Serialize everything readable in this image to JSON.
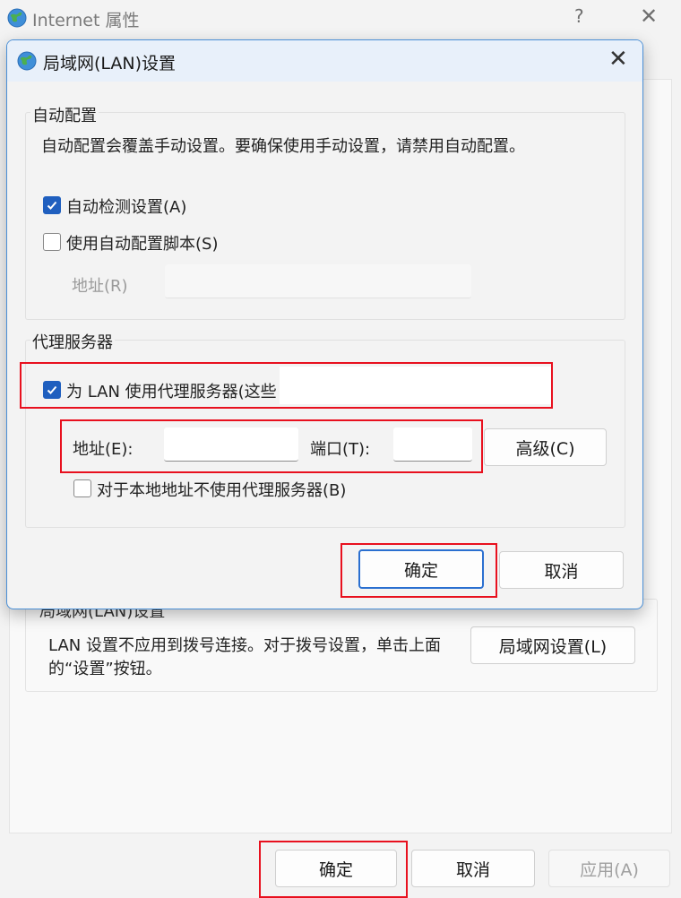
{
  "parent_window": {
    "title": "Internet 属性",
    "help_glyph": "?",
    "close_glyph": "✕",
    "lan_group": {
      "title": "局域网(LAN)设置",
      "description": "LAN 设置不应用到拨号连接。对于拨号设置，单击上面的“设置”按钮。",
      "button_label": "局域网设置(L)"
    },
    "footer": {
      "ok_label": "确定",
      "cancel_label": "取消",
      "apply_label": "应用(A)"
    }
  },
  "lan_dialog": {
    "title": "局域网(LAN)设置",
    "close_glyph": "✕",
    "auto_config": {
      "title": "自动配置",
      "description": "自动配置会覆盖手动设置。要确保使用手动设置，请禁用自动配置。",
      "auto_detect": {
        "label": "自动检测设置(A)",
        "checked": true
      },
      "use_script": {
        "label": "使用自动配置脚本(S)",
        "checked": false
      },
      "address_label": "地址(R)",
      "address_value": ""
    },
    "proxy": {
      "title": "代理服务器",
      "use_proxy": {
        "label": "为 LAN 使用代理服务器(这些",
        "checked": true
      },
      "address_label": "地址(E):",
      "address_value": "",
      "port_label": "端口(T):",
      "port_value": "",
      "advanced_label": "高级(C)",
      "bypass_local": {
        "label": "对于本地地址不使用代理服务器(B)",
        "checked": false
      }
    },
    "ok_label": "确定",
    "cancel_label": "取消"
  },
  "colors": {
    "highlight_red": "#e8101e",
    "checkbox_blue": "#1f5fbf",
    "dialog_border_blue": "#4a8fd6"
  },
  "icons": [
    "globe-icon",
    "close-icon",
    "help-icon",
    "checkmark-icon"
  ]
}
